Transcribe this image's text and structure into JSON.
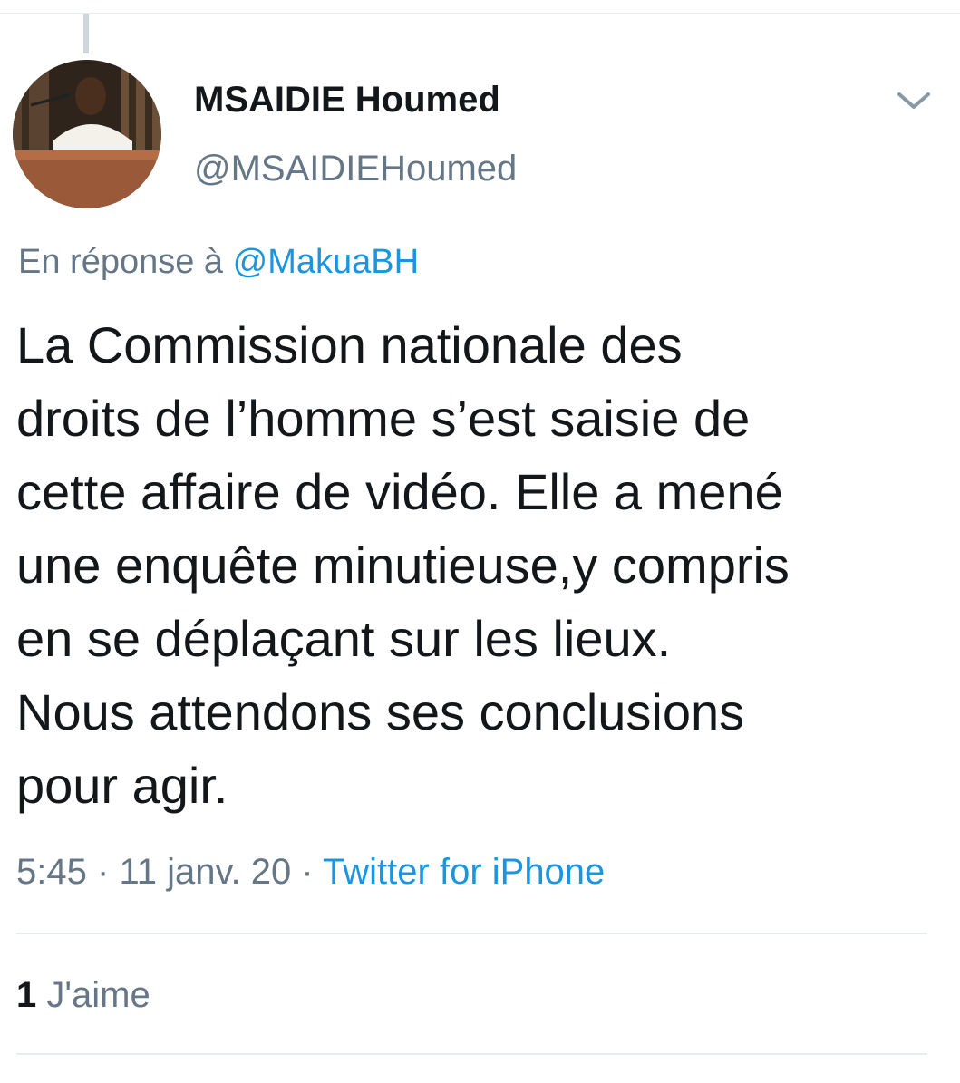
{
  "author": {
    "display_name": "MSAIDIE Houmed",
    "handle": "@MSAIDIEHoumed",
    "avatar_icon": "profile-photo"
  },
  "reply": {
    "prefix": "En réponse à",
    "mention": "@MakuaBH"
  },
  "tweet": {
    "text": "La Commission nationale des\ndroits de l’homme s’est saisie de\ncette affaire de vidéo. Elle a mené\nune enquête minutieuse,y compris\nen se déplaçant sur les lieux.\nNous attendons ses conclusions\npour agir."
  },
  "meta": {
    "time": "5:45",
    "separator": "·",
    "date": "11 janv. 20",
    "source": "Twitter for iPhone"
  },
  "engagement": {
    "likes_count": "1",
    "likes_label": "J'aime"
  },
  "colors": {
    "text": "#14171a",
    "secondary": "#657786",
    "link": "#1b95e0",
    "divider": "#e6ecf0"
  }
}
